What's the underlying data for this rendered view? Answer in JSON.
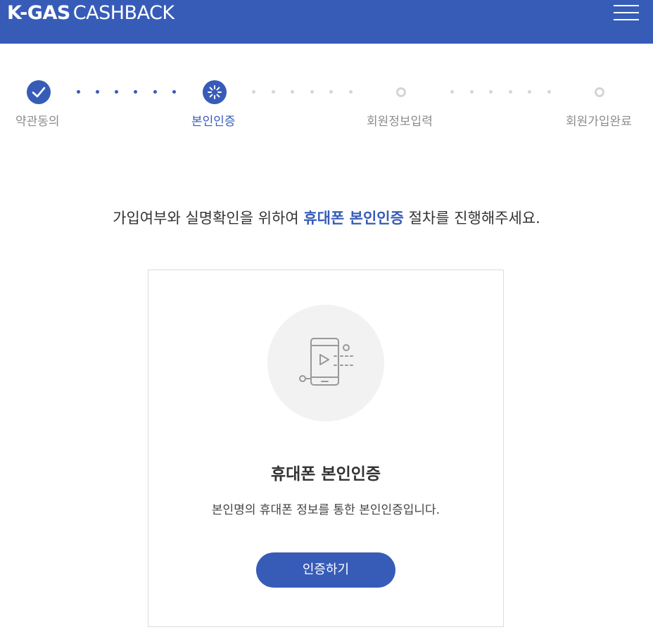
{
  "header": {
    "logo_bold": "K-GAS",
    "logo_light": "CASHBACK"
  },
  "steps": [
    {
      "label": "약관동의",
      "state": "done"
    },
    {
      "label": "본인인증",
      "state": "active"
    },
    {
      "label": "회원정보입력",
      "state": "pending"
    },
    {
      "label": "회원가입완료",
      "state": "pending"
    }
  ],
  "intro": {
    "before": "가입여부와 실명확인을 위하여 ",
    "highlight": "휴대폰 본인인증",
    "after": " 절차를 진행해주세요."
  },
  "card": {
    "icon": "smartphone-play-icon",
    "title": "휴대폰 본인인증",
    "description": "본인명의 휴대폰 정보를 통한 본인인증입니다.",
    "button_label": "인증하기"
  },
  "colors": {
    "brand": "#375cb8",
    "inactive": "#d4d4d4",
    "text": "#333333"
  }
}
